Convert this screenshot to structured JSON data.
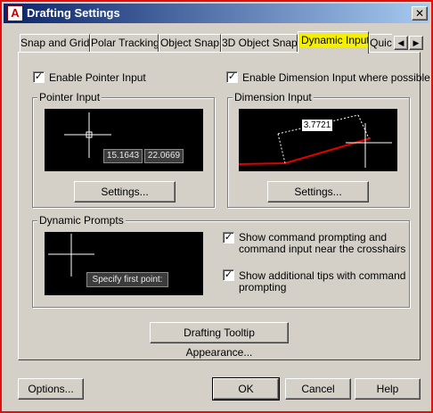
{
  "window": {
    "title": "Drafting Settings",
    "app_icon_letter": "A",
    "close_glyph": "✕"
  },
  "tabs": [
    {
      "label": "Snap and Grid",
      "active": false
    },
    {
      "label": "Polar Tracking",
      "active": false
    },
    {
      "label": "Object Snap",
      "active": false
    },
    {
      "label": "3D Object Snap",
      "active": false
    },
    {
      "label": "Dynamic Input",
      "active": true
    },
    {
      "label": "Quic",
      "active": false
    }
  ],
  "tab_scroll": {
    "left_icon": "arrow-left-icon",
    "right_icon": "arrow-right-icon"
  },
  "options": {
    "enable_pointer_input": {
      "label": "Enable Pointer Input",
      "checked": true
    },
    "enable_dimension_input": {
      "label": "Enable Dimension Input where possible",
      "checked": true
    }
  },
  "pointer_input": {
    "group_label": "Pointer Input",
    "x_value": "15.1643",
    "y_value": "22.0669",
    "settings_label": "Settings..."
  },
  "dimension_input": {
    "group_label": "Dimension Input",
    "dimension_value": "3.7721",
    "settings_label": "Settings..."
  },
  "dynamic_prompts": {
    "group_label": "Dynamic Prompts",
    "prompt_text": "Specify first point:",
    "show_command_prompting": {
      "label_line1": "Show command prompting and",
      "label_line2": "command input near the crosshairs",
      "checked": true
    },
    "show_additional_tips": {
      "label_line1": "Show additional tips with command",
      "label_line2": "prompting",
      "checked": true
    }
  },
  "buttons": {
    "tooltip_appearance": "Drafting Tooltip Appearance...",
    "options": "Options...",
    "ok": "OK",
    "cancel": "Cancel",
    "help": "Help"
  },
  "colors": {
    "highlight": "#f5f000",
    "preview_background": "#000000",
    "dimension_line": "#e00000",
    "window_border": "#e01010",
    "titlebar": "#0a246a"
  }
}
